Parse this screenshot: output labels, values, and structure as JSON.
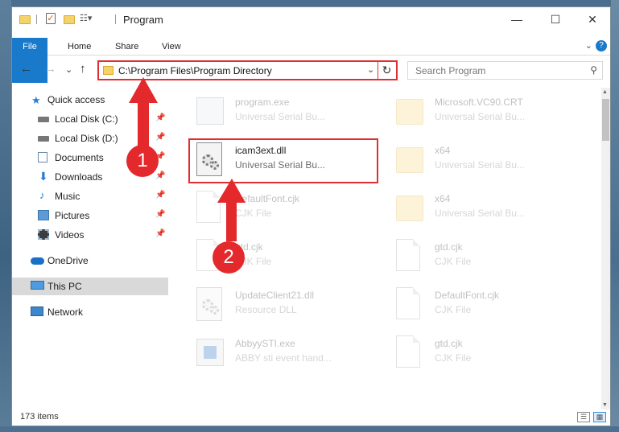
{
  "window": {
    "title": "Program",
    "minimize_glyph": "—",
    "maximize_glyph": "☐",
    "close_glyph": "✕"
  },
  "ribbon": {
    "tabs": [
      "File",
      "Home",
      "Share",
      "View"
    ],
    "expand_glyph": "⌄",
    "help_glyph": "?"
  },
  "nav": {
    "back_glyph": "←",
    "forward_glyph": "→",
    "recent_glyph": "⌄",
    "up_glyph": "↑"
  },
  "address": {
    "path": "C:\\Program Files\\Program Directory",
    "dropdown_glyph": "⌄",
    "refresh_glyph": "↻"
  },
  "search": {
    "placeholder": "Search Program",
    "icon_glyph": "⚲"
  },
  "sidebar": {
    "pin_glyph": "📌",
    "items": [
      {
        "label": "Quick access",
        "icon": "star-icon"
      },
      {
        "label": "Local Disk (C:)",
        "icon": "drive-icon",
        "pinned": true
      },
      {
        "label": "Local Disk (D:)",
        "icon": "drive-icon",
        "pinned": true
      },
      {
        "label": "Documents",
        "icon": "documents-icon",
        "pinned": true
      },
      {
        "label": "Downloads",
        "icon": "download-icon",
        "pinned": true
      },
      {
        "label": "Music",
        "icon": "music-icon",
        "pinned": true
      },
      {
        "label": "Pictures",
        "icon": "pictures-icon",
        "pinned": true
      },
      {
        "label": "Videos",
        "icon": "videos-icon",
        "pinned": true
      },
      {
        "label": "OneDrive",
        "icon": "cloud-icon"
      },
      {
        "label": "This PC",
        "icon": "computer-icon",
        "selected": true
      },
      {
        "label": "Network",
        "icon": "network-icon"
      }
    ]
  },
  "files": [
    {
      "name": "program.exe",
      "type": "Universal Serial Bu...",
      "icon": "installer-icon"
    },
    {
      "name": "Microsoft.VC90.CRT",
      "type": "Universal Serial Bu...",
      "icon": "folder-icon"
    },
    {
      "name": "icam3ext.dll",
      "type": "Universal Serial Bu...",
      "icon": "dll-gear-icon"
    },
    {
      "name": "x64",
      "type": "Universal Serial Bu...",
      "icon": "folder-icon"
    },
    {
      "name": "DefaultFont.cjk",
      "type": "CJK File",
      "icon": "document-icon"
    },
    {
      "name": "x64",
      "type": "Universal Serial Bu...",
      "icon": "folder-icon"
    },
    {
      "name": "gtd.cjk",
      "type": "CJK File",
      "icon": "document-icon"
    },
    {
      "name": "gtd.cjk",
      "type": "CJK File",
      "icon": "document-icon"
    },
    {
      "name": "UpdateClient21.dll",
      "type": "Resource DLL",
      "icon": "dll-gear-icon"
    },
    {
      "name": "DefaultFont.cjk",
      "type": "CJK File",
      "icon": "document-icon"
    },
    {
      "name": "AbbyySTI.exe",
      "type": "ABBY sti event hand...",
      "icon": "exe-icon"
    },
    {
      "name": "gtd.cjk",
      "type": "CJK File",
      "icon": "document-icon"
    }
  ],
  "status": {
    "item_count": "173 items",
    "details_view_glyph": "☰",
    "large_icons_view_glyph": "▦"
  },
  "annotations": {
    "badge_1": "1",
    "badge_2": "2",
    "color": "#e3292c"
  },
  "colors": {
    "accent": "#1979ca",
    "highlight": "#e02f32",
    "folder": "#f8d775"
  }
}
